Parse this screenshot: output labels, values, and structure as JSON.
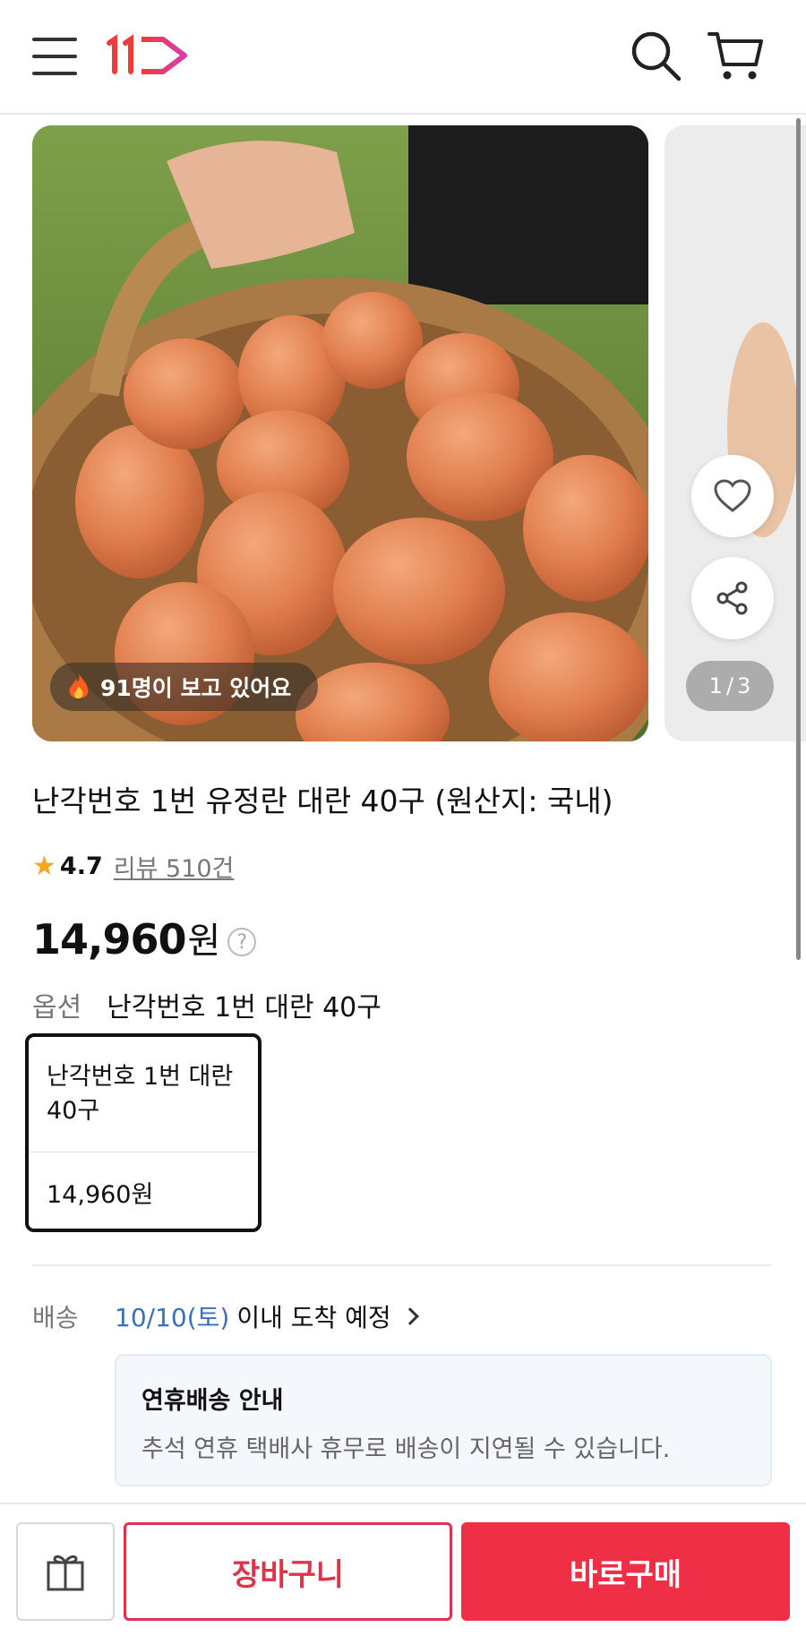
{
  "header": {
    "menu_icon": "hamburger-icon",
    "logo_icon": "11st-logo",
    "search_icon": "search-icon",
    "cart_icon": "cart-icon"
  },
  "gallery": {
    "viewers_text": "91명이 보고 있어요",
    "current_page": "1",
    "separator": "/",
    "total_pages": "3",
    "like_icon": "heart-icon",
    "share_icon": "share-icon"
  },
  "product": {
    "title": "난각번호 1번 유정란 대란 40구 (원산지: 국내)",
    "rating": "4.7",
    "review_text": "리뷰 510건",
    "price": "14,960",
    "price_unit": "원",
    "help_symbol": "?",
    "option_label": "옵션",
    "option_value": "난각번호 1번 대란 40구",
    "option_card": {
      "name": "난각번호 1번 대란 40구",
      "price": "14,960원"
    }
  },
  "delivery": {
    "label": "배송",
    "date": "10/10(토)",
    "text": "이내 도착 예정",
    "notice_title": "연휴배송 안내",
    "notice_text": "추석 연휴 택배사 휴무로 배송이 지연될 수 있습니다."
  },
  "bottom_bar": {
    "gift_icon": "gift-icon",
    "cart_label": "장바구니",
    "buy_label": "바로구매"
  },
  "colors": {
    "accent": "#ee2f45",
    "date_blue": "#3b6fb6",
    "star": "#f5a623"
  }
}
